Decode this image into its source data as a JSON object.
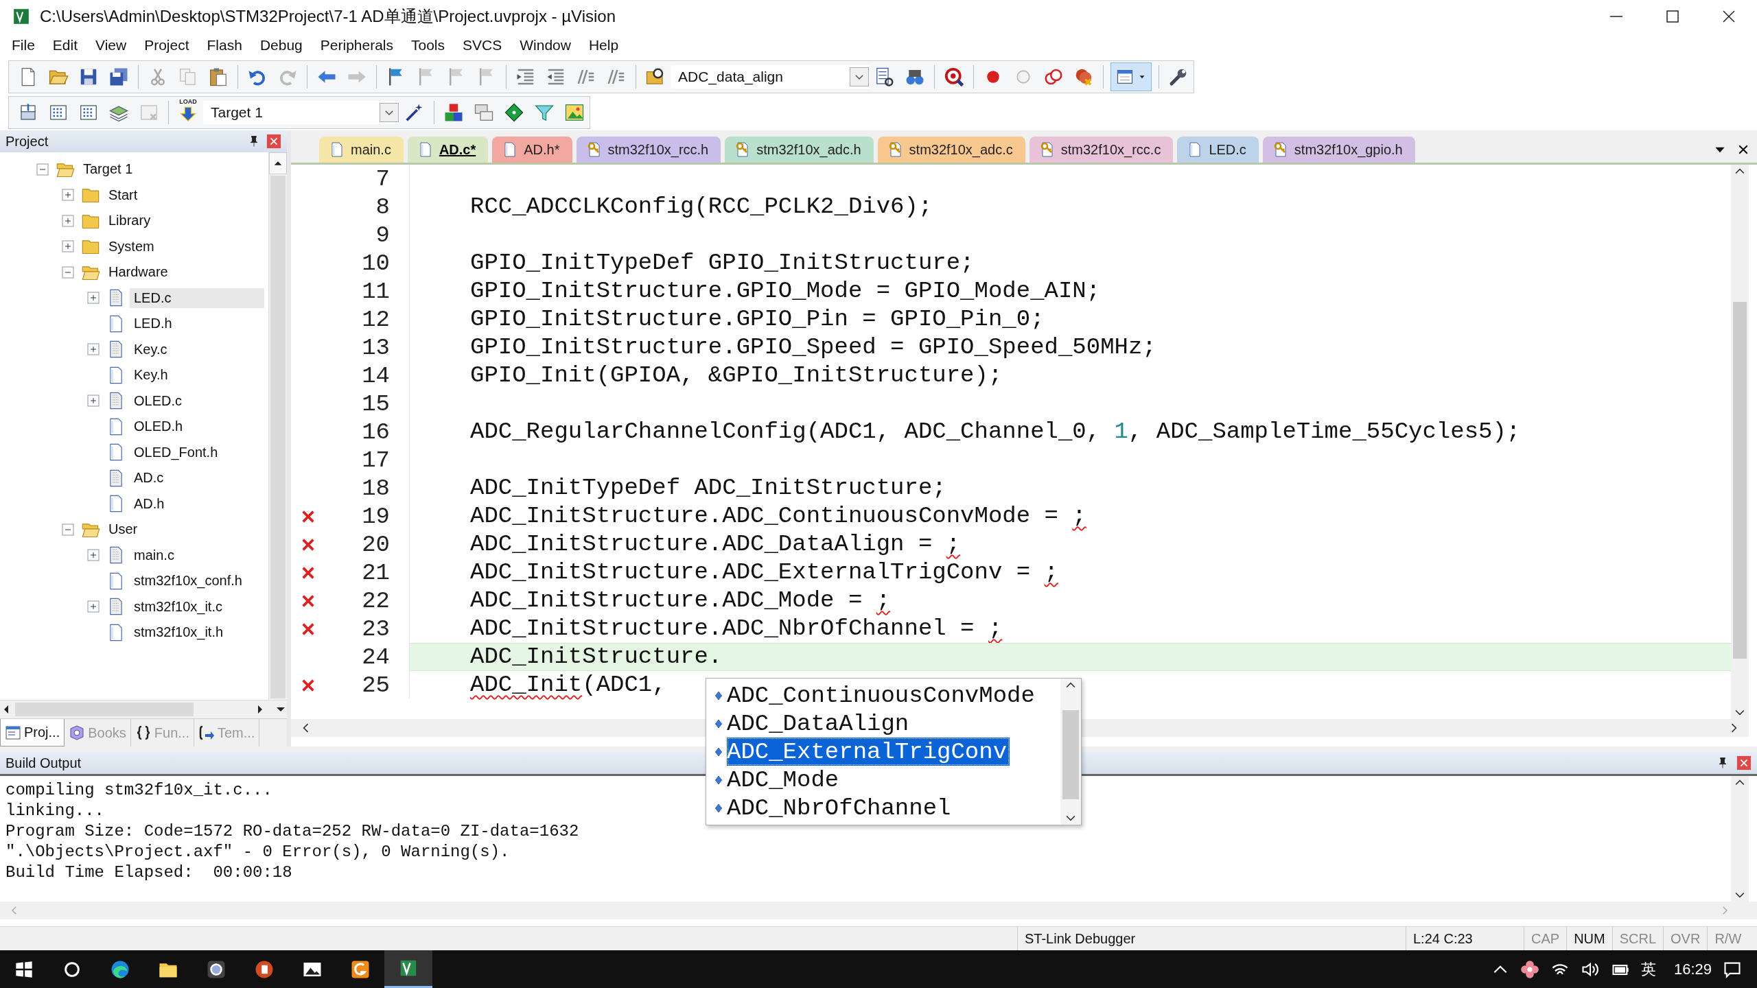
{
  "window": {
    "title": "C:\\Users\\Admin\\Desktop\\STM32Project\\7-1 AD单通道\\Project.uvprojx - µVision"
  },
  "menu": [
    "File",
    "Edit",
    "View",
    "Project",
    "Flash",
    "Debug",
    "Peripherals",
    "Tools",
    "SVCS",
    "Window",
    "Help"
  ],
  "toolbar": {
    "find_combo": "ADC_data_align",
    "load_label": "LOAD",
    "target_combo": "Target 1"
  },
  "project_panel": {
    "title": "Project",
    "tree": [
      {
        "label": "Target 1",
        "kind": "target",
        "expanded": true,
        "selected": false,
        "children": [
          {
            "label": "Start",
            "kind": "group",
            "expanded": false,
            "selected": false
          },
          {
            "label": "Library",
            "kind": "group",
            "expanded": false,
            "selected": false
          },
          {
            "label": "System",
            "kind": "group",
            "expanded": false,
            "selected": false
          },
          {
            "label": "Hardware",
            "kind": "group",
            "expanded": true,
            "selected": false,
            "children": [
              {
                "label": "LED.c",
                "kind": "source",
                "expanded": false,
                "selected": true
              },
              {
                "label": "LED.h",
                "kind": "header",
                "selected": false
              },
              {
                "label": "Key.c",
                "kind": "source",
                "expanded": false,
                "selected": false
              },
              {
                "label": "Key.h",
                "kind": "header",
                "selected": false
              },
              {
                "label": "OLED.c",
                "kind": "source",
                "expanded": false,
                "selected": false
              },
              {
                "label": "OLED.h",
                "kind": "header",
                "selected": false
              },
              {
                "label": "OLED_Font.h",
                "kind": "header",
                "selected": false
              },
              {
                "label": "AD.c",
                "kind": "source",
                "selected": false
              },
              {
                "label": "AD.h",
                "kind": "header",
                "selected": false
              }
            ]
          },
          {
            "label": "User",
            "kind": "group",
            "expanded": true,
            "selected": false,
            "children": [
              {
                "label": "main.c",
                "kind": "source",
                "expanded": false,
                "selected": false
              },
              {
                "label": "stm32f10x_conf.h",
                "kind": "header",
                "selected": false
              },
              {
                "label": "stm32f10x_it.c",
                "kind": "source",
                "expanded": false,
                "selected": false
              },
              {
                "label": "stm32f10x_it.h",
                "kind": "header",
                "selected": false
              }
            ]
          }
        ]
      }
    ],
    "tabs": [
      {
        "label": "Proj...",
        "kind": "project",
        "selected": true
      },
      {
        "label": "Books",
        "kind": "books",
        "selected": false
      },
      {
        "label": "Fun...",
        "kind": "functions",
        "selected": false
      },
      {
        "label": "Tem...",
        "kind": "templates",
        "selected": false
      }
    ]
  },
  "editor": {
    "tabs": [
      {
        "label": "main.c",
        "color": "#f5e6a8",
        "readonly": false,
        "selected": false
      },
      {
        "label": "AD.c*",
        "color": "#d9e8c4",
        "readonly": false,
        "selected": true
      },
      {
        "label": "AD.h*",
        "color": "#f2a8a0",
        "readonly": false,
        "selected": false
      },
      {
        "label": "stm32f10x_rcc.h",
        "color": "#c9bde9",
        "readonly": true,
        "selected": false
      },
      {
        "label": "stm32f10x_adc.h",
        "color": "#b9e0cc",
        "readonly": true,
        "selected": false
      },
      {
        "label": "stm32f10x_adc.c",
        "color": "#f8c88e",
        "readonly": true,
        "selected": false
      },
      {
        "label": "stm32f10x_rcc.c",
        "color": "#e8c2d6",
        "readonly": true,
        "selected": false
      },
      {
        "label": "LED.c",
        "color": "#bcd3ea",
        "readonly": false,
        "selected": false
      },
      {
        "label": "stm32f10x_gpio.h",
        "color": "#d3bfe3",
        "readonly": true,
        "selected": false
      }
    ],
    "lines": [
      {
        "number": "7",
        "error": false,
        "current": false
      },
      {
        "number": "8",
        "error": false,
        "current": false,
        "tokens": [
          {
            "text": "RCC_ADCCLKConfig(RCC_PCLK2_Div6);",
            "kind": "plain"
          }
        ]
      },
      {
        "number": "9",
        "error": false,
        "current": false
      },
      {
        "number": "10",
        "error": false,
        "current": false,
        "tokens": [
          {
            "text": "GPIO_InitTypeDef GPIO_InitStructure;",
            "kind": "plain"
          }
        ]
      },
      {
        "number": "11",
        "error": false,
        "current": false,
        "tokens": [
          {
            "text": "GPIO_InitStructure.GPIO_Mode = GPIO_Mode_AIN;",
            "kind": "plain"
          }
        ]
      },
      {
        "number": "12",
        "error": false,
        "current": false,
        "tokens": [
          {
            "text": "GPIO_InitStructure.GPIO_Pin = GPIO_Pin_0;",
            "kind": "plain"
          }
        ]
      },
      {
        "number": "13",
        "error": false,
        "current": false,
        "tokens": [
          {
            "text": "GPIO_InitStructure.GPIO_Speed = GPIO_Speed_50MHz;",
            "kind": "plain"
          }
        ]
      },
      {
        "number": "14",
        "error": false,
        "current": false,
        "tokens": [
          {
            "text": "GPIO_Init(GPIOA, &GPIO_InitStructure);",
            "kind": "plain"
          }
        ]
      },
      {
        "number": "15",
        "error": false,
        "current": false
      },
      {
        "number": "16",
        "error": false,
        "current": false,
        "tokens": [
          {
            "text": "ADC_RegularChannelConfig(ADC1, ADC_Channel_0, ",
            "kind": "plain"
          },
          {
            "text": "1",
            "kind": "number"
          },
          {
            "text": ", ADC_SampleTime_55Cycles5);",
            "kind": "plain"
          }
        ]
      },
      {
        "number": "17",
        "error": false,
        "current": false
      },
      {
        "number": "18",
        "error": false,
        "current": false,
        "tokens": [
          {
            "text": "ADC_InitTypeDef ADC_InitStructure;",
            "kind": "plain"
          }
        ]
      },
      {
        "number": "19",
        "error": true,
        "current": false,
        "tokens": [
          {
            "text": "ADC_InitStructure.ADC_ContinuousConvMode = ",
            "kind": "plain"
          },
          {
            "text": ";",
            "kind": "squiggle"
          }
        ]
      },
      {
        "number": "20",
        "error": true,
        "current": false,
        "tokens": [
          {
            "text": "ADC_InitStructure.ADC_DataAlign = ",
            "kind": "plain"
          },
          {
            "text": ";",
            "kind": "squiggle"
          }
        ]
      },
      {
        "number": "21",
        "error": true,
        "current": false,
        "tokens": [
          {
            "text": "ADC_InitStructure.ADC_ExternalTrigConv = ",
            "kind": "plain"
          },
          {
            "text": ";",
            "kind": "squiggle"
          }
        ]
      },
      {
        "number": "22",
        "error": true,
        "current": false,
        "tokens": [
          {
            "text": "ADC_InitStructure.ADC_Mode = ",
            "kind": "plain"
          },
          {
            "text": ";",
            "kind": "squiggle"
          }
        ]
      },
      {
        "number": "23",
        "error": true,
        "current": false,
        "tokens": [
          {
            "text": "ADC_InitStructure.ADC_NbrOfChannel = ",
            "kind": "plain"
          },
          {
            "text": ";",
            "kind": "squiggle"
          }
        ]
      },
      {
        "number": "24",
        "error": false,
        "current": true,
        "tokens": [
          {
            "text": "ADC_InitStructure.",
            "kind": "plain"
          }
        ]
      },
      {
        "number": "25",
        "error": true,
        "current": false,
        "tokens": [
          {
            "text": "ADC_Init",
            "kind": "squiggle"
          },
          {
            "text": "(ADC1,",
            "kind": "plain"
          }
        ]
      }
    ],
    "completion": [
      {
        "label": "ADC_ContinuousConvMode",
        "selected": false
      },
      {
        "label": "ADC_DataAlign",
        "selected": false
      },
      {
        "label": "ADC_ExternalTrigConv",
        "selected": true
      },
      {
        "label": "ADC_Mode",
        "selected": false
      },
      {
        "label": "ADC_NbrOfChannel",
        "selected": false
      }
    ]
  },
  "build_output": {
    "title": "Build Output",
    "lines": [
      "compiling stm32f10x_it.c...",
      "linking...",
      "Program Size: Code=1572 RO-data=252 RW-data=0 ZI-data=1632",
      "\".\\Objects\\Project.axf\" - 0 Error(s), 0 Warning(s).",
      "Build Time Elapsed:  00:00:18"
    ]
  },
  "status_bar": {
    "debugger": "ST-Link Debugger",
    "position": "L:24 C:23",
    "indicators": [
      {
        "label": "CAP",
        "on": false
      },
      {
        "label": "NUM",
        "on": true
      },
      {
        "label": "SCRL",
        "on": false
      },
      {
        "label": "OVR",
        "on": false
      },
      {
        "label": "R/W",
        "on": false
      }
    ]
  },
  "taskbar": {
    "apps": [
      {
        "kind": "browser",
        "selected": false
      },
      {
        "kind": "folder",
        "selected": false
      },
      {
        "kind": "camera",
        "selected": false
      },
      {
        "kind": "slides",
        "selected": false
      },
      {
        "kind": "photos",
        "selected": false
      },
      {
        "kind": "orange",
        "selected": false
      },
      {
        "kind": "keil",
        "selected": true
      }
    ],
    "input_method": "英",
    "time": "16:29"
  }
}
